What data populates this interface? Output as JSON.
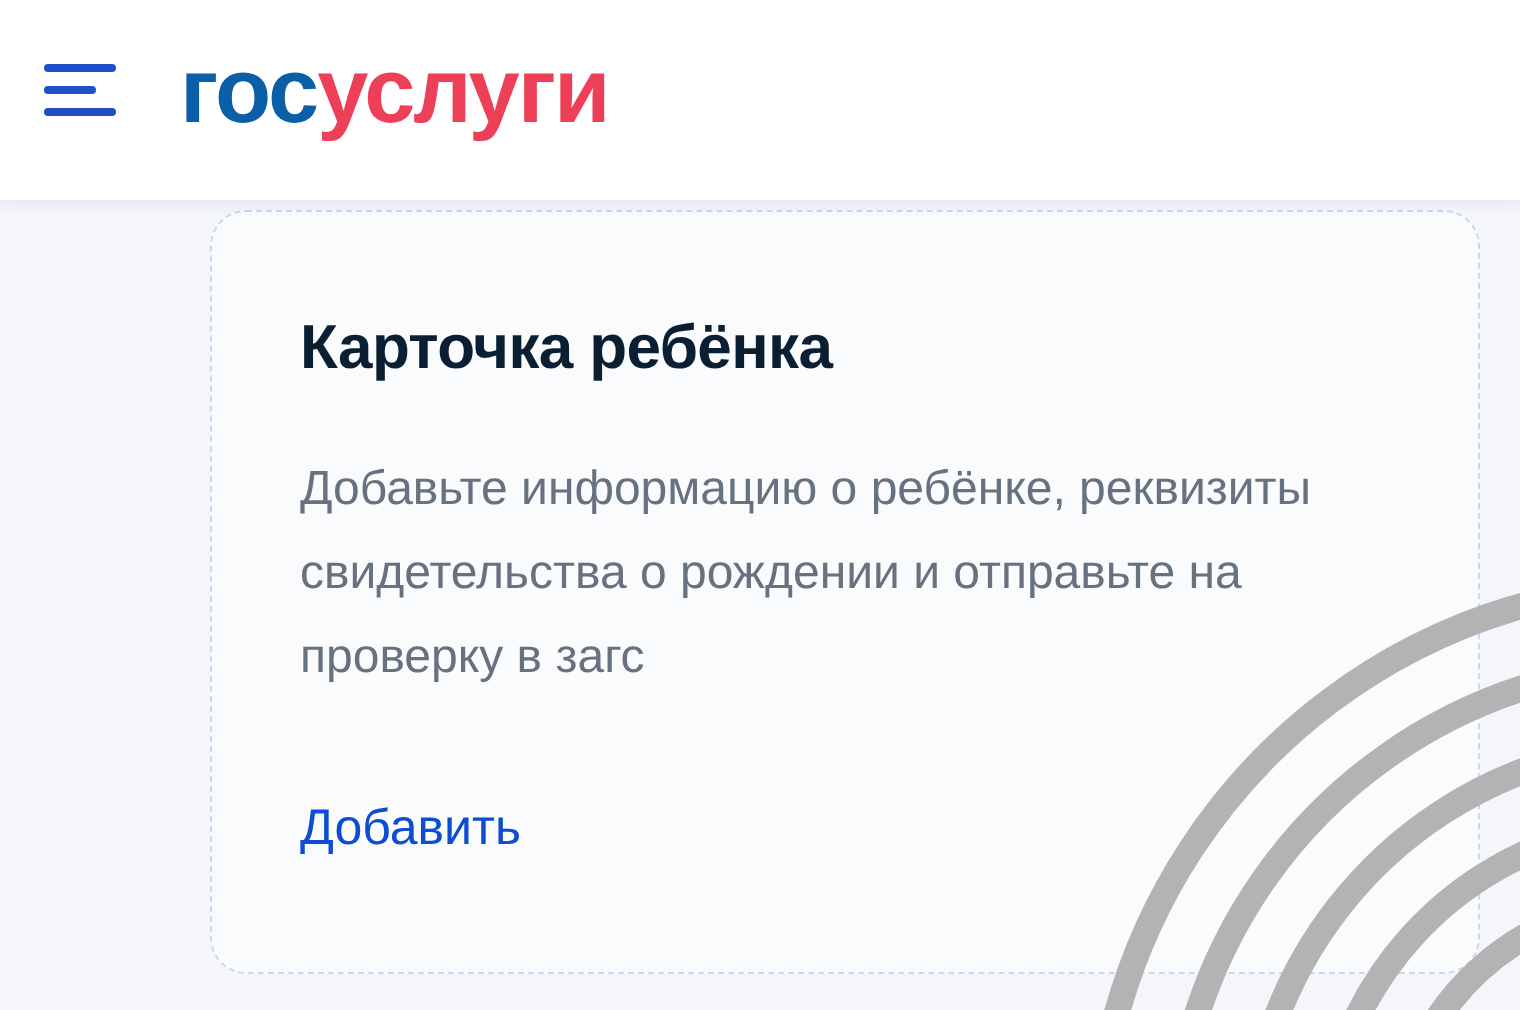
{
  "header": {
    "logo": {
      "part_1": "гос",
      "part_2": "услуги"
    }
  },
  "card": {
    "title": "Карточка ребёнка",
    "description": "Добавьте информацию о ребёнке, реквизиты свидетельства о рождении и отправьте на проверку в загс",
    "link": "Добавить"
  }
}
